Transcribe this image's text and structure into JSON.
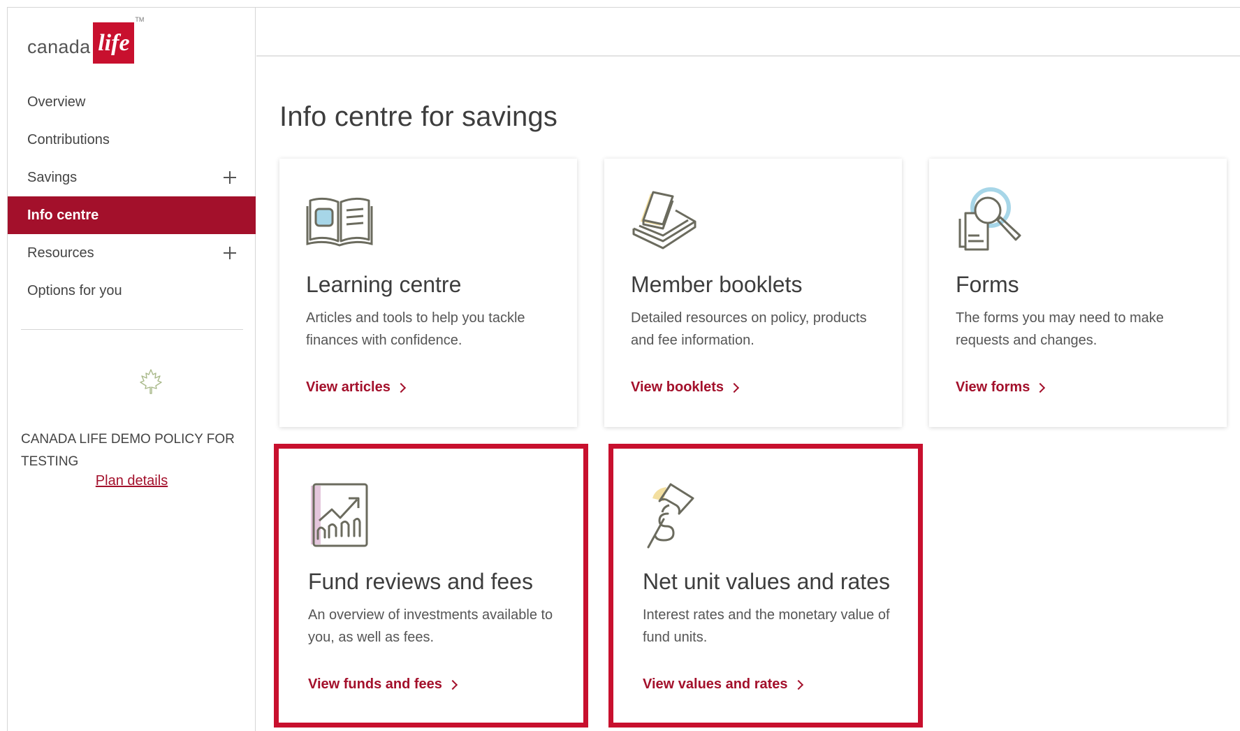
{
  "brand": {
    "word": "canada",
    "mark": "life",
    "tm": "TM",
    "accent_color": "#a3102b"
  },
  "sidebar": {
    "items": [
      {
        "label": "Overview",
        "expandable": false,
        "active": false
      },
      {
        "label": "Contributions",
        "expandable": false,
        "active": false
      },
      {
        "label": "Savings",
        "expandable": true,
        "active": false
      },
      {
        "label": "Info centre",
        "expandable": false,
        "active": true
      },
      {
        "label": "Resources",
        "expandable": true,
        "active": false
      },
      {
        "label": "Options for you",
        "expandable": false,
        "active": false
      }
    ],
    "policy_name": "CANADA LIFE DEMO POLICY FOR TESTING",
    "plan_link": "Plan details"
  },
  "main": {
    "title": "Info centre for savings",
    "cards": [
      {
        "icon": "open-book-icon",
        "title": "Learning centre",
        "description": "Articles and tools to help you tackle finances with confidence.",
        "link": "View articles",
        "highlighted": false
      },
      {
        "icon": "booklets-stack-icon",
        "title": "Member booklets",
        "description": "Detailed resources on policy, products and fee information.",
        "link": "View booklets",
        "highlighted": false
      },
      {
        "icon": "forms-magnifier-icon",
        "title": "Forms",
        "description": "The forms you may need to make requests and changes.",
        "link": "View forms",
        "highlighted": false
      },
      {
        "icon": "growth-chart-icon",
        "title": "Fund reviews and fees",
        "description": "An overview of investments available to you, as well as fees.",
        "link": "View funds and fees",
        "highlighted": true
      },
      {
        "icon": "pushpin-dollar-icon",
        "title": "Net unit values and rates",
        "description": "Interest rates and the monetary value of fund units.",
        "link": "View values and rates",
        "highlighted": true
      }
    ]
  }
}
